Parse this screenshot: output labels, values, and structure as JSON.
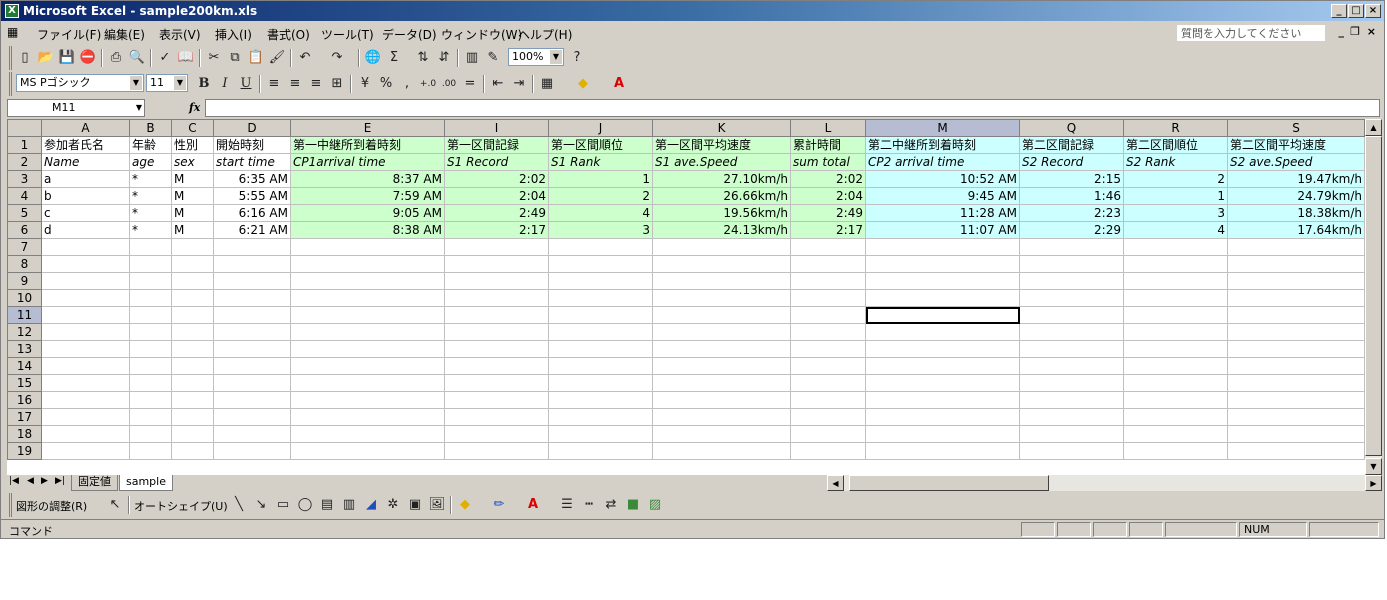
{
  "window": {
    "title": "Microsoft Excel - sample200km.xls",
    "min": "_",
    "max": "□",
    "close": "×"
  },
  "menubar": {
    "items": [
      "ファイル(F)",
      "編集(E)",
      "表示(V)",
      "挿入(I)",
      "書式(O)",
      "ツール(T)",
      "データ(D)",
      "ウィンドウ(W)",
      "ヘルプ(H)"
    ],
    "help_placeholder": "質問を入力してください",
    "mdi_min": "_",
    "mdi_restore": "❐",
    "mdi_close": "×"
  },
  "standard_toolbar": {
    "zoom": "100%"
  },
  "format_toolbar": {
    "font": "MS Pゴシック",
    "size": "11",
    "bold": "B",
    "italic": "I",
    "underline": "U",
    "percent": "%",
    "comma": ",",
    "inc_dec": "+.0",
    "dec_dec": ".00"
  },
  "formula_bar": {
    "name_box": "M11",
    "fx": "fx",
    "formula": ""
  },
  "grid": {
    "columns": [
      "A",
      "B",
      "C",
      "D",
      "E",
      "I",
      "J",
      "K",
      "L",
      "M",
      "Q",
      "R",
      "S"
    ],
    "row_numbers": [
      "1",
      "2",
      "3",
      "4",
      "5",
      "6",
      "7",
      "8",
      "9",
      "10",
      "11",
      "12",
      "13",
      "14",
      "15",
      "16",
      "17",
      "18",
      "19"
    ],
    "header_row": [
      "参加者氏名",
      "年齢",
      "性別",
      "開始時刻",
      "第一中継所到着時刻",
      "第一区間記録",
      "第一区間順位",
      "第一区間平均速度",
      "累計時間",
      "第二中継所到着時刻",
      "第二区間記録",
      "第二区間順位",
      "第二区間平均速度"
    ],
    "sub_header": [
      "Name",
      "age",
      "sex",
      "start time",
      "CP1arrival time",
      "S1 Record",
      "S1 Rank",
      "S1 ave.Speed",
      "sum total",
      "CP2 arrival time",
      "S2 Record",
      "S2 Rank",
      "S2 ave.Speed"
    ],
    "rows": [
      [
        "a",
        "*",
        "M",
        "6:35 AM",
        "8:37 AM",
        "2:02",
        "1",
        "27.10km/h",
        "2:02",
        "10:52 AM",
        "2:15",
        "2",
        "19.47km/h"
      ],
      [
        "b",
        "*",
        "M",
        "5:55 AM",
        "7:59 AM",
        "2:04",
        "2",
        "26.66km/h",
        "2:04",
        "9:45 AM",
        "1:46",
        "1",
        "24.79km/h"
      ],
      [
        "c",
        "*",
        "M",
        "6:16 AM",
        "9:05 AM",
        "2:49",
        "4",
        "19.56km/h",
        "2:49",
        "11:28 AM",
        "2:23",
        "3",
        "18.38km/h"
      ],
      [
        "d",
        "*",
        "M",
        "6:21 AM",
        "8:38 AM",
        "2:17",
        "3",
        "24.13km/h",
        "2:17",
        "11:07 AM",
        "2:29",
        "4",
        "17.64km/h"
      ]
    ]
  },
  "sheet_tabs": [
    "固定値",
    "sample"
  ],
  "draw_toolbar": {
    "shape_adjust": "図形の調整(R)",
    "autoshape": "オートシェイプ(U)"
  },
  "status": {
    "mode": "コマンド",
    "num": "NUM"
  },
  "colors": {
    "green_fill": "#ccffcc",
    "cyan_fill": "#ccffff",
    "titlebar": "#0a246a"
  }
}
